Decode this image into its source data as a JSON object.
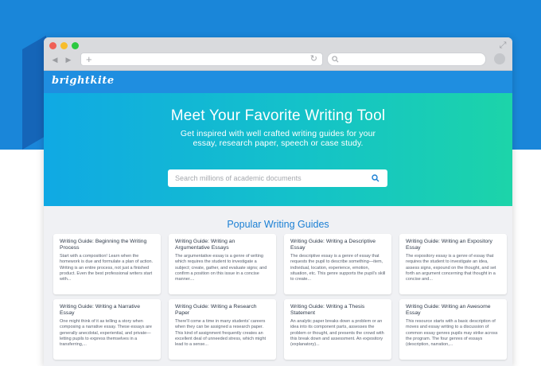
{
  "colors": {
    "background_blue": "#1a86d9",
    "app_bar": "#1f8ee0",
    "hero_gradient_start": "#10a9e4",
    "hero_gradient_end": "#1cd4a9",
    "section_title": "#1a7fd4"
  },
  "browser": {
    "buttons": [
      "close",
      "minimize",
      "zoom"
    ],
    "back_icon": "chevron-left-icon",
    "forward_icon": "chevron-right-icon",
    "new_tab_icon": "plus-icon",
    "reload_icon": "reload-icon",
    "search_icon": "search-icon",
    "expand_icon": "expand-icon"
  },
  "app": {
    "logo": "brightkite"
  },
  "hero": {
    "title": "Meet Your Favorite Writing Tool",
    "subtitle": "Get inspired with well crafted writing guides for your essay, research paper, speech or case study.",
    "search_placeholder": "Search millions of academic documents"
  },
  "guides": {
    "title": "Popular Writing Guides",
    "cards": [
      {
        "title": "Writing Guide: Beginning the Writing Process",
        "text": "Start with a composition! Learn when the homework is due and formulate a plan of action. Writing is an entire process, not just a finished product. Even the best professional writers start with..."
      },
      {
        "title": "Writing Guide: Writing an Argumentative Essays",
        "text": "The argumentative essay is a genre of writing which requires the student to investigate a subject; create, gather, and evaluate signs; and confirm a position on this issue in a concise manner...."
      },
      {
        "title": "Writing Guide: Writing a Descriptive Essay",
        "text": "The descriptive essay is a genre of essay that requests the pupil to describe something—item, individual, location, experience, emotion, situation, etc. This genre supports the pupil's skill to create..."
      },
      {
        "title": "Writing Guide: Writing an Expository Essay",
        "text": "The expository essay is a genre of essay that requires the student to investigate an idea, assess signs, expound on the thought, and set forth an argument concerning that thought in a concise and..."
      },
      {
        "title": "Writing Guide: Writing a Narrative Essay",
        "text": "One might think of it as telling a story when composing a narrative essay. These essays are generally anecdotal, experiential, and private—letting pupils to express themselves in a transferring,..."
      },
      {
        "title": "Writing Guide: Writing a Research Paper",
        "text": "There'll come a time in many students' careers when they can be assigned a research paper. This kind of assignment frequently creates an excellent deal of unneeded stress, which might lead to a sense..."
      },
      {
        "title": "Writing Guide: Writing a Thesis Statement",
        "text": "An analytic paper breaks down a problem or an idea into its component parts, assesses the problem or thought, and presents the crowd with this break down and assessment. An expository (explanatory)..."
      },
      {
        "title": "Writing Guide: Writing an Awesome Essay",
        "text": "This resource starts with a basic description of moves and essay writing to a discussion of common essay genres pupils may strike across the program. The four genres of essays (description, narration,..."
      }
    ]
  }
}
